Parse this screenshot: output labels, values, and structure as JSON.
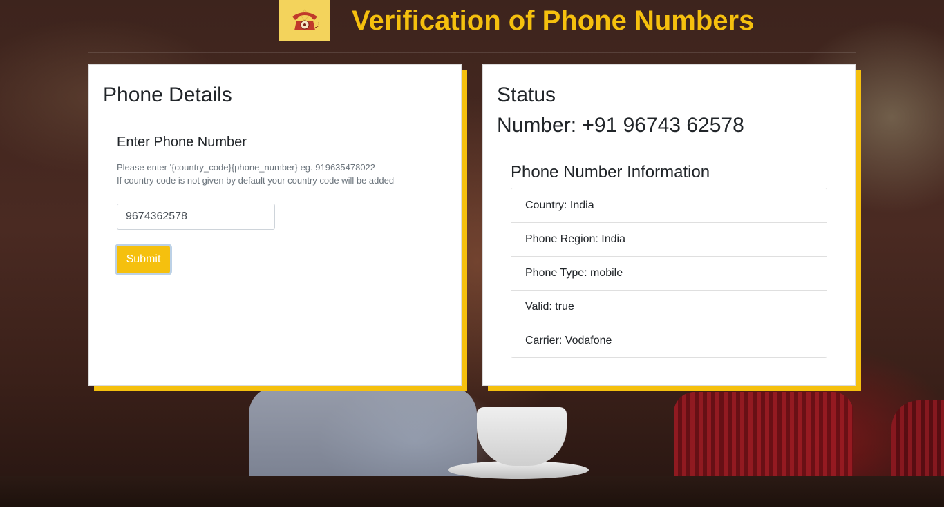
{
  "header": {
    "title": "Verification of Phone Numbers",
    "logo_icon": "telephone-icon"
  },
  "colors": {
    "accent": "#f5c00e",
    "logo_bg": "#f3d35c",
    "phone_red": "#c0392b"
  },
  "form_card": {
    "title": "Phone Details",
    "heading": "Enter Phone Number",
    "hint_line1": "Please enter '{country_code}{phone_number} eg. 919635478022",
    "hint_line2": "If country code is not given by default your country code will be added",
    "phone_input_value": "9674362578",
    "submit_label": "Submit"
  },
  "status_card": {
    "title": "Status",
    "number_line": "Number: +91 96743 62578",
    "info_heading": "Phone Number Information",
    "info_items": [
      "Country: India",
      "Phone Region: India",
      "Phone Type: mobile",
      "Valid: true",
      "Carrier: Vodafone"
    ]
  }
}
